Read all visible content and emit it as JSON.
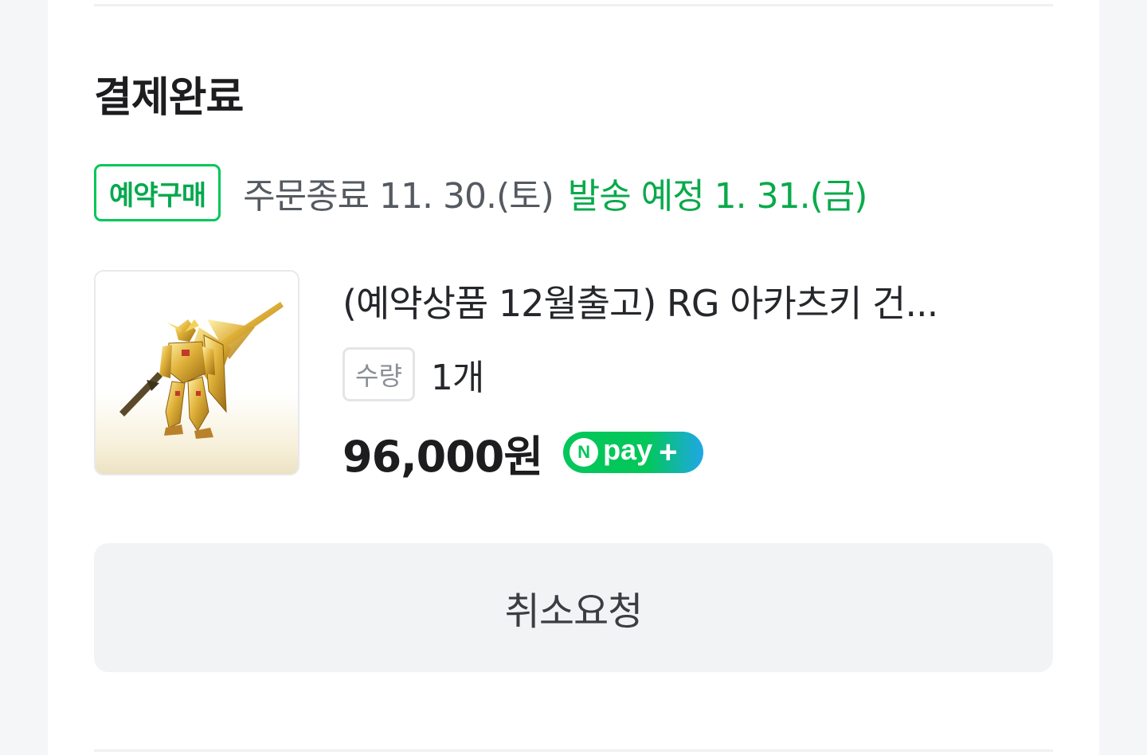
{
  "order": {
    "status": "결제완료",
    "badge": "예약구매",
    "order_end": "주문종료 11. 30.(토)",
    "ship_info": "발송 예정 1. 31.(금)"
  },
  "product": {
    "name": "(예약상품 12월출고) RG 아카츠키 건...",
    "qty_label": "수량",
    "qty_value": "1개",
    "price": "96,000원",
    "thumbnail": "gold-gundam-figure-image"
  },
  "npay": {
    "n": "N",
    "text": "pay",
    "plus": "+"
  },
  "actions": {
    "cancel_label": "취소요청"
  },
  "colors": {
    "accent_green": "#03c75a",
    "ship_text": "#09aa4b",
    "npay_gradient_end": "#1fa7e8"
  }
}
